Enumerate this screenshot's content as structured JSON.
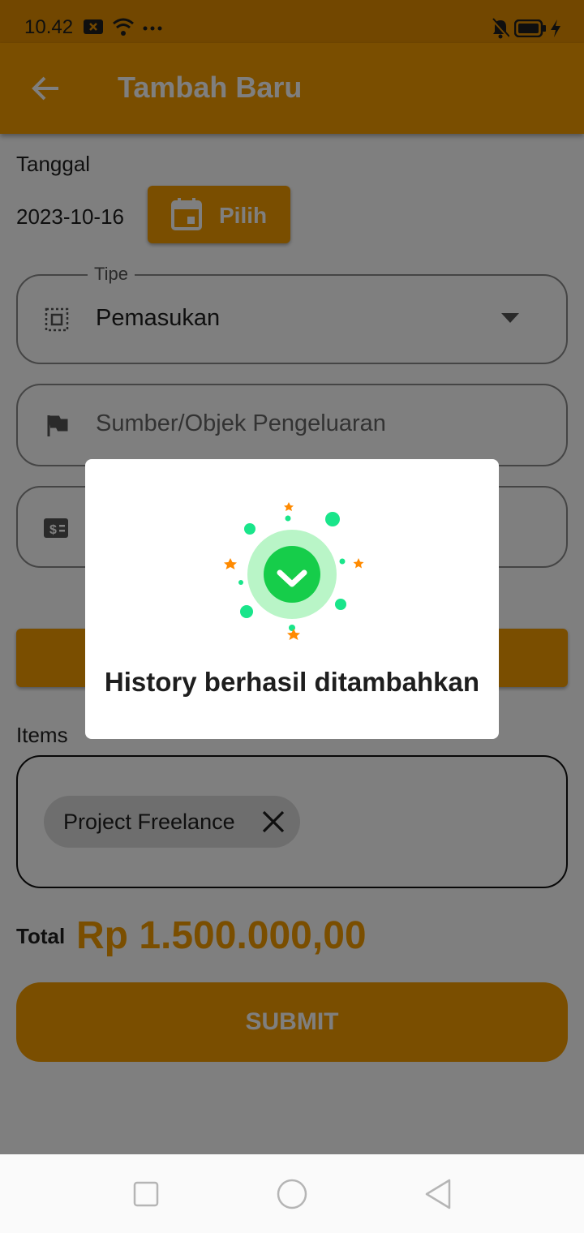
{
  "status_bar": {
    "time": "10.42",
    "icons": [
      "notification-x-icon",
      "wifi-icon",
      "more-dots-icon",
      "bell-off-icon",
      "battery-icon",
      "charging-bolt-icon"
    ]
  },
  "app_bar": {
    "title": "Tambah Baru",
    "back_icon": "arrow-back-icon"
  },
  "date": {
    "label": "Tanggal",
    "value": "2023-10-16",
    "pick_button": "Pilih",
    "icon": "calendar-icon"
  },
  "type_field": {
    "label": "Tipe",
    "value": "Pemasukan",
    "icon": "select-all-icon",
    "dropdown_icon": "caret-down-icon"
  },
  "source_field": {
    "placeholder": "Sumber/Objek Pengeluaran",
    "icon": "flag-icon"
  },
  "amount_field": {
    "icon": "money-icon"
  },
  "items": {
    "label": "Items",
    "chips": [
      {
        "label": "Project Freelance",
        "remove_icon": "close-icon"
      }
    ]
  },
  "total": {
    "label": "Total",
    "value": "Rp 1.500.000,00"
  },
  "submit": {
    "label": "SUBMIT"
  },
  "dialog": {
    "message": "History berhasil ditambahkan",
    "icon": "success-check-icon"
  },
  "colors": {
    "primary": "#f59c00",
    "success": "#16cd4a",
    "success_ring": "#b9f5c7",
    "confetti_green": "#19e58a",
    "confetti_star": "#ff8a00"
  },
  "nav_bar": {
    "buttons": [
      "recent-apps-icon",
      "home-icon",
      "back-triangle-icon"
    ]
  }
}
